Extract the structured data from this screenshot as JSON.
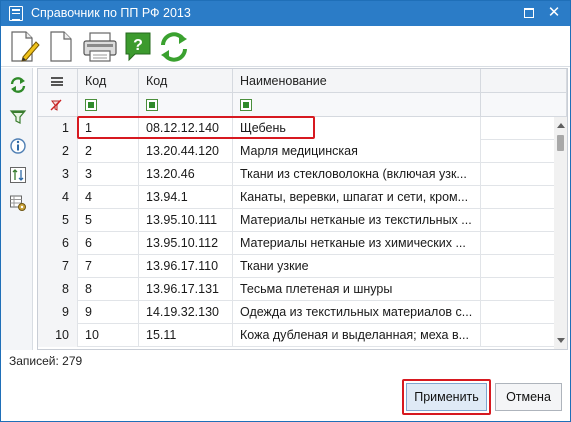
{
  "window": {
    "title": "Справочник по ПП РФ 2013",
    "controls": [
      "restore-icon",
      "close-icon"
    ],
    "close_glyph": "✕"
  },
  "toolbar": {
    "icons": [
      "document-edit-icon",
      "document-blank-icon",
      "printer-icon",
      "help-icon",
      "refresh-icon"
    ],
    "help_glyph": "?"
  },
  "sidebar": {
    "icons": [
      "refresh-small-icon",
      "filter-icon",
      "info-icon",
      "sort-icon",
      "grid-settings-icon"
    ]
  },
  "grid": {
    "columns": [
      "Код",
      "Код",
      "Наименование"
    ],
    "rows": [
      {
        "n": "1",
        "code": "1",
        "okpd": "08.12.12.140",
        "name": "Щебень"
      },
      {
        "n": "2",
        "code": "2",
        "okpd": "13.20.44.120",
        "name": "Марля медицинская"
      },
      {
        "n": "3",
        "code": "3",
        "okpd": "13.20.46",
        "name": "Ткани из стекловолокна (включая узк..."
      },
      {
        "n": "4",
        "code": "4",
        "okpd": "13.94.1",
        "name": "Канаты, веревки, шпагат и сети, кром..."
      },
      {
        "n": "5",
        "code": "5",
        "okpd": "13.95.10.111",
        "name": "Материалы нетканые из текстильных ..."
      },
      {
        "n": "6",
        "code": "6",
        "okpd": "13.95.10.112",
        "name": "Материалы нетканые из химических ..."
      },
      {
        "n": "7",
        "code": "7",
        "okpd": "13.96.17.110",
        "name": "Ткани узкие"
      },
      {
        "n": "8",
        "code": "8",
        "okpd": "13.96.17.131",
        "name": "Тесьма плетеная и шнуры"
      },
      {
        "n": "9",
        "code": "9",
        "okpd": "14.19.32.130",
        "name": "Одежда из текстильных материалов с..."
      },
      {
        "n": "10",
        "code": "10",
        "okpd": "15.11",
        "name": "Кожа дубленая и выделанная; меха в..."
      }
    ]
  },
  "status": {
    "records": "Записей: 279"
  },
  "buttons": {
    "apply": "Применить",
    "cancel": "Отмена"
  },
  "colors": {
    "titlebar": "#2b7cc7",
    "highlight": "#d71920",
    "accent_green": "#2f8a2a"
  }
}
